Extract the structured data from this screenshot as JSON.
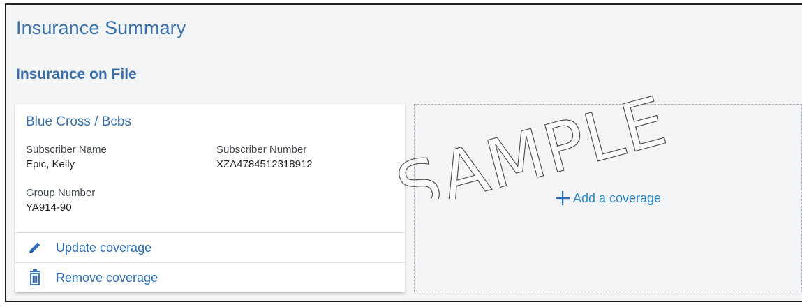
{
  "header": {
    "title": "Insurance Summary",
    "subtitle": "Insurance on File"
  },
  "coverage_card": {
    "plan_name": "Blue Cross / Bcbs",
    "subscriber_name_label": "Subscriber Name",
    "subscriber_name_value": "Epic, Kelly",
    "subscriber_number_label": "Subscriber Number",
    "subscriber_number_value": "XZA4784512318912",
    "group_number_label": "Group Number",
    "group_number_value": "YA914-90",
    "update_label": "Update coverage",
    "update_icon": "pencil-icon",
    "remove_label": "Remove coverage",
    "remove_icon": "trash-icon"
  },
  "add_coverage": {
    "icon": "plus-icon",
    "label": "Add a coverage"
  },
  "watermark": {
    "text": "SAMPLE"
  },
  "colors": {
    "heading": "#3a6fa8",
    "link": "#2e6db4",
    "background": "#f3f4f6",
    "card": "#ffffff"
  }
}
